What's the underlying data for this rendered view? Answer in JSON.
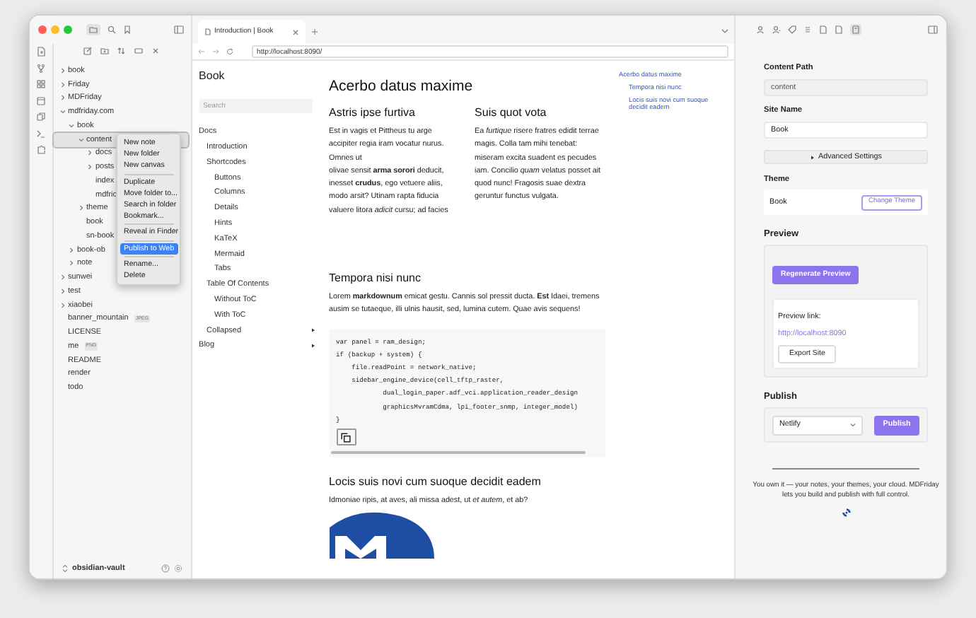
{
  "explorer": {
    "tree": [
      {
        "label": "book",
        "kind": "folder",
        "expanded": false,
        "selected": false
      },
      {
        "label": "Friday",
        "kind": "folder",
        "expanded": false,
        "selected": false
      },
      {
        "label": "MDFriday",
        "kind": "folder",
        "expanded": false,
        "selected": false
      },
      {
        "label": "mdfriday.com",
        "kind": "folder",
        "expanded": true,
        "selected": false,
        "children": [
          {
            "label": "book",
            "kind": "folder",
            "expanded": true,
            "selected": false,
            "children": [
              {
                "label": "content",
                "kind": "folder",
                "expanded": true,
                "selected": true,
                "children": [
                  {
                    "label": "docs",
                    "kind": "folder",
                    "expanded": false,
                    "selected": false
                  },
                  {
                    "label": "posts",
                    "kind": "folder",
                    "expanded": false,
                    "selected": false
                  },
                  {
                    "label": "index",
                    "kind": "file",
                    "selected": false
                  },
                  {
                    "label": "mdfric",
                    "kind": "file",
                    "selected": false
                  }
                ]
              },
              {
                "label": "theme",
                "kind": "folder",
                "expanded": false,
                "selected": false
              },
              {
                "label": "book",
                "kind": "file",
                "selected": false
              },
              {
                "label": "sn-book",
                "kind": "file",
                "selected": false
              }
            ]
          },
          {
            "label": "book-ob",
            "kind": "folder",
            "expanded": false,
            "selected": false
          },
          {
            "label": "note",
            "kind": "folder",
            "expanded": false,
            "selected": false
          }
        ]
      },
      {
        "label": "sunwei",
        "kind": "folder",
        "expanded": false,
        "selected": false
      },
      {
        "label": "test",
        "kind": "folder",
        "expanded": false,
        "selected": false
      },
      {
        "label": "xiaobei",
        "kind": "folder",
        "expanded": false,
        "selected": false
      },
      {
        "label": "banner_mountain",
        "kind": "file",
        "badge": "JPEG",
        "selected": false
      },
      {
        "label": "LICENSE",
        "kind": "file",
        "selected": false
      },
      {
        "label": "me",
        "kind": "file",
        "badge": "PNG",
        "selected": false
      },
      {
        "label": "README",
        "kind": "file",
        "selected": false
      },
      {
        "label": "render",
        "kind": "file",
        "selected": false
      },
      {
        "label": "todo",
        "kind": "file",
        "selected": false
      }
    ],
    "vault": "obsidian-vault"
  },
  "context_menu": {
    "groups": [
      [
        {
          "label": "New note",
          "selected": false
        },
        {
          "label": "New folder",
          "selected": false
        },
        {
          "label": "New canvas",
          "selected": false
        }
      ],
      [
        {
          "label": "Duplicate",
          "selected": false
        },
        {
          "label": "Move folder to...",
          "selected": false
        },
        {
          "label": "Search in folder",
          "selected": false
        },
        {
          "label": "Bookmark...",
          "selected": false
        }
      ],
      [
        {
          "label": "Reveal in Finder",
          "selected": false
        }
      ],
      [
        {
          "label": "Publish to Web",
          "selected": true
        }
      ],
      [
        {
          "label": "Rename...",
          "selected": false
        },
        {
          "label": "Delete",
          "selected": false
        }
      ]
    ]
  },
  "tabs": [
    {
      "title": "Introduction | Book",
      "selected": true
    }
  ],
  "address_bar": {
    "url": "http://localhost:8090/"
  },
  "site": {
    "title": "Book",
    "search": {
      "placeholder": "Search"
    },
    "nav": [
      {
        "label": "Docs",
        "children": [
          {
            "label": "Introduction"
          },
          {
            "label": "Shortcodes",
            "children": [
              {
                "label": "Buttons"
              },
              {
                "label": "Columns"
              },
              {
                "label": "Details"
              },
              {
                "label": "Hints"
              },
              {
                "label": "KaTeX"
              },
              {
                "label": "Mermaid"
              },
              {
                "label": "Tabs"
              }
            ]
          },
          {
            "label": "Table Of Contents",
            "children": [
              {
                "label": "Without ToC"
              },
              {
                "label": "With ToC"
              }
            ]
          },
          {
            "label": "Collapsed",
            "expanded": false
          }
        ]
      },
      {
        "label": "Blog",
        "expanded": false
      }
    ]
  },
  "article": {
    "title": "Acerbo datus maxime",
    "columns": [
      {
        "heading": "Astris ipse furtiva",
        "paragraphs": [
          "Est in vagis et Pittheus tu arge accipiter regia iram vocatur nurus. Omnes ut",
          "olivae sensit **arma sorori** deducit, inesset **crudus**, ego vetuere aliis, modo arsit? Utinam rapta fiducia valuere litora *adicit* cursu; ad facies"
        ]
      },
      {
        "heading": "Suis quot vota",
        "paragraphs": [
          "Ea *furtique* risere fratres edidit terrae magis. Colla tam mihi tenebat:",
          "miseram excita suadent es pecudes iam. Concilio *quam* velatus posset ait quod nunc! Fragosis suae dextra geruntur functus vulgata."
        ]
      }
    ],
    "sections": [
      {
        "heading": "Tempora nisi nunc",
        "paragraphs": [
          "Lorem **markdownum** emicat gestu. Cannis sol pressit ducta. **Est** Idaei, tremens ausim se tutaeque, illi ulnis hausit, sed, lumina cutem. Quae avis sequens!"
        ],
        "code": [
          "var panel = ram_design;",
          "if (backup + system) {",
          "    file.readPoint = network_native;",
          "    sidebar_engine_device(cell_tftp_raster,",
          "            dual_login_paper.adf_vci.application_reader_design",
          "            graphicsMvramCdma, lpi_footer_snmp, integer_model)",
          "}"
        ]
      },
      {
        "heading": "Locis suis novi cum suoque decidit eadem",
        "paragraphs": [
          "Idmoniae ripis, at aves, ali missa adest, ut *et autem*, et ab?"
        ],
        "image": {
          "kind": "picture"
        }
      }
    ]
  },
  "toc": [
    {
      "label": "Acerbo datus maxime",
      "children": [
        {
          "label": "Tempora nisi nunc"
        },
        {
          "label": "Locis suis novi cum suoque decidit eadem"
        }
      ]
    }
  ],
  "panel": {
    "content_path": {
      "label": "Content Path",
      "value": "content",
      "disabled": true
    },
    "site_name": {
      "label": "Site Name",
      "value": "Book",
      "disabled": false
    },
    "advanced": {
      "label": "Advanced Settings",
      "expanded": false
    },
    "theme": {
      "label": "Theme",
      "value": "Book",
      "button": "Change Theme"
    },
    "preview": {
      "heading": "Preview",
      "button": "Regenerate Preview",
      "link_label": "Preview link:",
      "link": "http://localhost:8090",
      "export_button": "Export Site"
    },
    "publish": {
      "heading": "Publish",
      "target": "Netlify",
      "button": "Publish"
    },
    "footer": "You own it — your notes, your themes, your cloud. MDFriday lets you build and publish with full control."
  }
}
